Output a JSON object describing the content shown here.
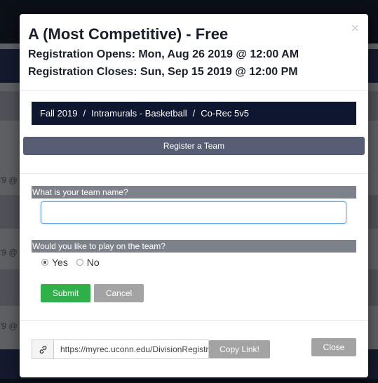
{
  "background": {
    "partial_texts": [
      "'9 @",
      "'9 @",
      "'9 @"
    ]
  },
  "modal": {
    "title": "A (Most Competitive) - Free",
    "close_glyph": "×",
    "registration_opens": "Registration Opens: Mon, Aug 26 2019 @ 12:00 AM",
    "registration_closes": "Registration Closes: Sun, Sep 15 2019 @ 12:00 PM",
    "breadcrumb": {
      "items": [
        "Fall 2019",
        "Intramurals - Basketball",
        "Co-Rec 5v5"
      ],
      "separator": "/"
    },
    "register_label": "Register a Team",
    "form": {
      "team_name_label": "What is your team name?",
      "team_name_value": "",
      "play_label": "Would you like to play on the team?",
      "options": [
        {
          "label": "Yes",
          "selected": true
        },
        {
          "label": "No",
          "selected": false
        }
      ],
      "submit_label": "Submit",
      "cancel_label": "Cancel"
    },
    "footer": {
      "link_icon": "link-icon",
      "link_url": "https://myrec.uconn.edu/DivisionRegistration",
      "copy_label": "Copy Link!",
      "close_label": "Close"
    }
  },
  "colors": {
    "breadcrumb_bg": "#0f1630",
    "register_bar_bg": "#575d73",
    "label_bg": "#7d8189",
    "submit_bg": "#2fb14a",
    "neutral_button_bg": "#a3a3a3"
  }
}
